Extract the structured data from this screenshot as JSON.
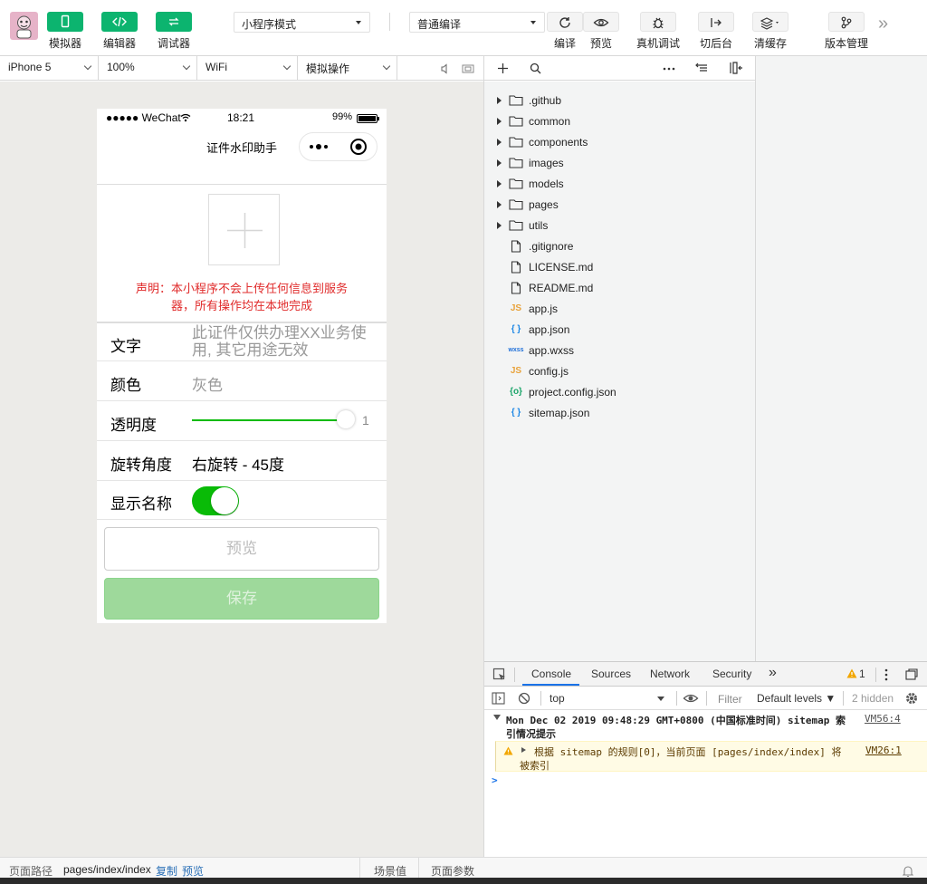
{
  "toolbar": {
    "simulator_label": "模拟器",
    "editor_label": "编辑器",
    "debugger_label": "调试器",
    "mode_select": "小程序模式",
    "compile_select": "普通编译",
    "compile_label": "编译",
    "preview_label": "预览",
    "remote_debug_label": "真机调试",
    "background_label": "切后台",
    "clear_cache_label": "清缓存",
    "version_label": "版本管理",
    "accent_color": "#0cb46f"
  },
  "subbar": {
    "device": "iPhone 5",
    "zoom": "100%",
    "network": "WiFi",
    "sim_ops": "模拟操作"
  },
  "phone": {
    "signal": "●●●●● WeChat",
    "time": "18:21",
    "battery": "99%",
    "nav_title": "证件水印助手",
    "notice": "声明：本小程序不会上传任何信息到服务器，所有操作均在本地完成",
    "notice_line1": "声明：本小程序不会上传任何信息到服务",
    "notice_line2": "器，所有操作均在本地完成",
    "form": {
      "text_label": "文字",
      "text_placeholder_line1": "此证件仅供办理XX业务使",
      "text_placeholder_line2": "用, 其它用途无效",
      "color_label": "颜色",
      "color_value": "灰色",
      "opacity_label": "透明度",
      "opacity_value": "1",
      "opacity_fraction": 1.0,
      "rotate_label": "旋转角度",
      "rotate_value": "右旋转 - 45度",
      "show_name_label": "显示名称",
      "show_name_on": true
    },
    "preview_button": "预览",
    "save_button": "保存"
  },
  "files": [
    {
      "name": ".github",
      "type": "folder"
    },
    {
      "name": "common",
      "type": "folder"
    },
    {
      "name": "components",
      "type": "folder"
    },
    {
      "name": "images",
      "type": "folder"
    },
    {
      "name": "models",
      "type": "folder"
    },
    {
      "name": "pages",
      "type": "folder"
    },
    {
      "name": "utils",
      "type": "folder"
    },
    {
      "name": ".gitignore",
      "type": "file"
    },
    {
      "name": "LICENSE.md",
      "type": "file"
    },
    {
      "name": "README.md",
      "type": "file"
    },
    {
      "name": "app.js",
      "type": "js"
    },
    {
      "name": "app.json",
      "type": "json"
    },
    {
      "name": "app.wxss",
      "type": "wxss"
    },
    {
      "name": "config.js",
      "type": "js"
    },
    {
      "name": "project.config.json",
      "type": "config"
    },
    {
      "name": "sitemap.json",
      "type": "json"
    }
  ],
  "file_icons": {
    "js": "JS",
    "json": "{ }",
    "wxss": "wxss",
    "config": "{o}"
  },
  "devtools": {
    "tabs": [
      "Console",
      "Sources",
      "Network",
      "Security"
    ],
    "more": "»",
    "warning_count": "1",
    "context": "top",
    "filter_placeholder": "Filter",
    "levels": "Default levels ▼",
    "hidden": "2 hidden",
    "log1_line1": "Mon Dec 02 2019 09:48:29 GMT+0800 (中国标准时间) sitemap 索",
    "log1_line2": "引情况提示",
    "log1_source": "VM56:4",
    "log2_line1": "根据 sitemap 的规则[0]，当前页面 [pages/index/index] 将",
    "log2_line2": "被索引",
    "log2_source": "VM26:1",
    "prompt": ">"
  },
  "statusbar": {
    "path_label": "页面路径",
    "path": "pages/index/index",
    "copy": "复制",
    "preview": "预览",
    "scene": "场景值",
    "params": "页面参数"
  }
}
